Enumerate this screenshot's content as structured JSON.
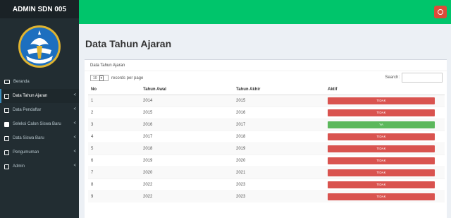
{
  "app": {
    "brand": "ADMIN SDN 005"
  },
  "sidebar": {
    "items": [
      {
        "label": "Beranda",
        "icon": "monitor-icon",
        "chevron": ""
      },
      {
        "label": "Data Tahun Ajaran",
        "icon": "file-icon",
        "chevron": "<"
      },
      {
        "label": "Data Pendaftar",
        "icon": "file-icon",
        "chevron": "<"
      },
      {
        "label": "Seleksi Calon Siswa Baru",
        "icon": "database-icon",
        "chevron": "<"
      },
      {
        "label": "Data Siswa Baru",
        "icon": "file-icon",
        "chevron": "<"
      },
      {
        "label": "Pengumuman",
        "icon": "file-icon",
        "chevron": "<"
      },
      {
        "label": "Admin",
        "icon": "file-icon",
        "chevron": "<"
      }
    ]
  },
  "page": {
    "title": "Data Tahun Ajaran"
  },
  "box": {
    "header": "Data Tahun Ajaran",
    "length_value": "10",
    "length_label": "records per page",
    "search_label": "Search:",
    "search_value": ""
  },
  "table": {
    "columns": [
      "No",
      "Tahun Awal",
      "Tahun Akhir",
      "Aktif"
    ],
    "rows": [
      {
        "no": "1",
        "awal": "2014",
        "akhir": "2015",
        "aktif": "TIDAK",
        "active": false
      },
      {
        "no": "2",
        "awal": "2015",
        "akhir": "2016",
        "aktif": "TIDAK",
        "active": false
      },
      {
        "no": "3",
        "awal": "2016",
        "akhir": "2017",
        "aktif": "YA",
        "active": true
      },
      {
        "no": "4",
        "awal": "2017",
        "akhir": "2018",
        "aktif": "TIDAK",
        "active": false
      },
      {
        "no": "5",
        "awal": "2018",
        "akhir": "2019",
        "aktif": "TIDAK",
        "active": false
      },
      {
        "no": "6",
        "awal": "2019",
        "akhir": "2020",
        "aktif": "TIDAK",
        "active": false
      },
      {
        "no": "7",
        "awal": "2020",
        "akhir": "2021",
        "aktif": "TIDAK",
        "active": false
      },
      {
        "no": "8",
        "awal": "2022",
        "akhir": "2023",
        "aktif": "TIDAK",
        "active": false
      },
      {
        "no": "9",
        "awal": "2022",
        "akhir": "2023",
        "aktif": "TIDAK",
        "active": false
      }
    ]
  },
  "colors": {
    "topbar": "#00c56b",
    "sidebar": "#222d32",
    "danger": "#d9534f",
    "success": "#5cb85c"
  }
}
